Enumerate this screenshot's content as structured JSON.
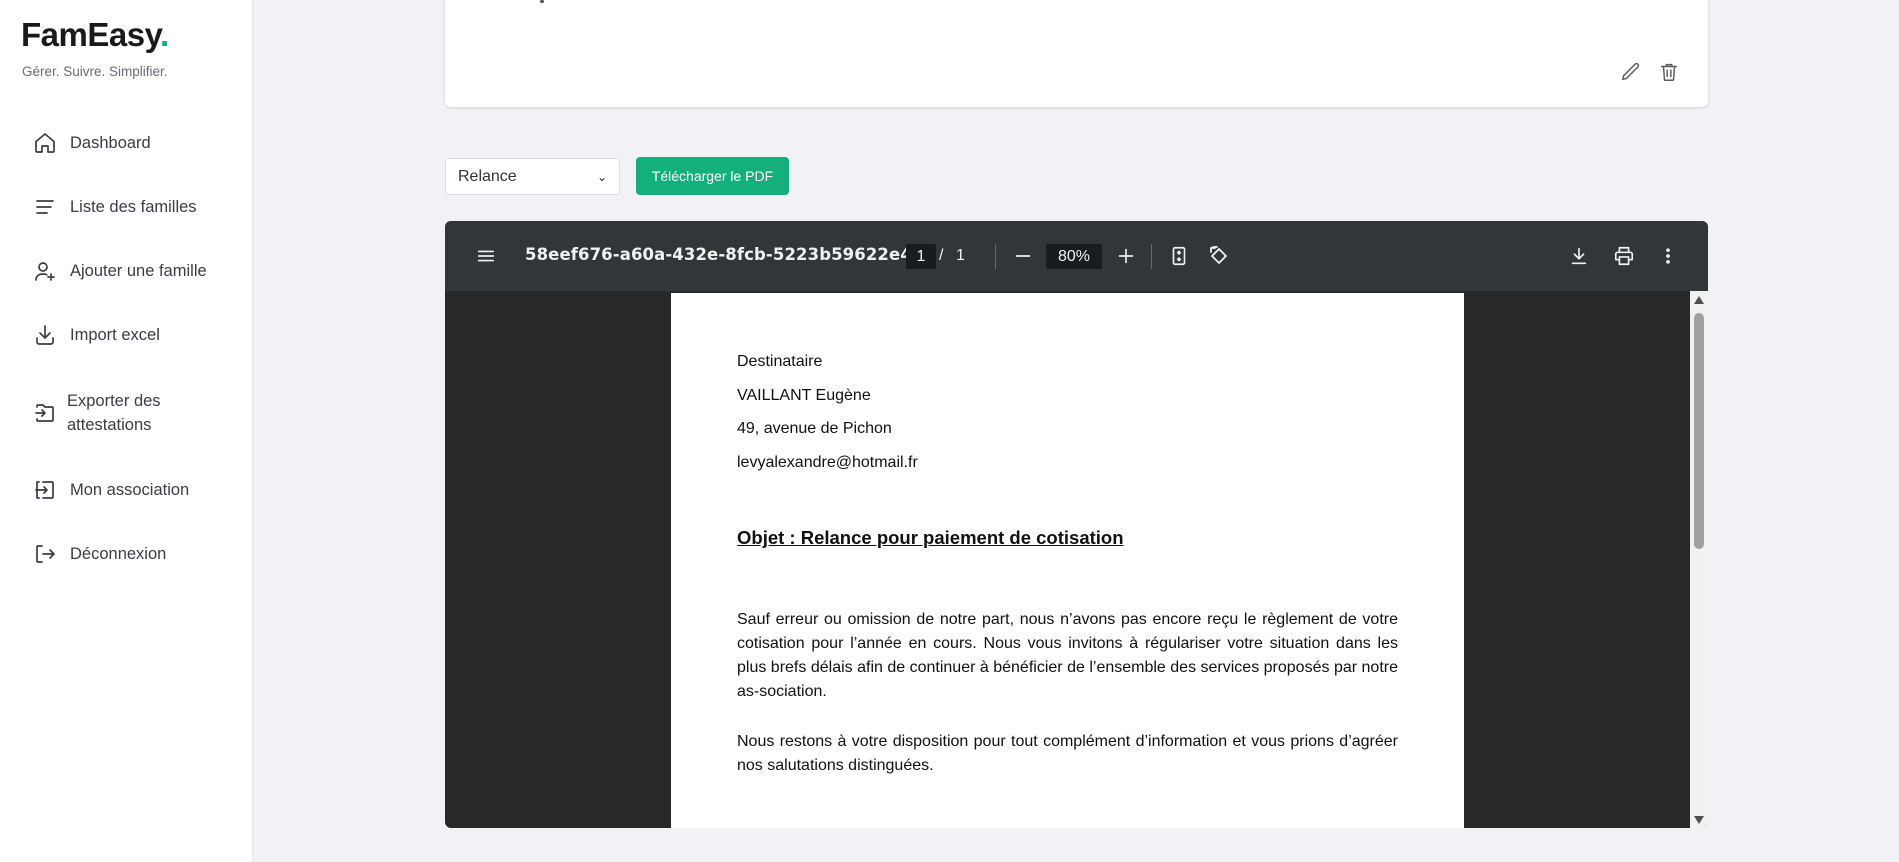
{
  "brand": {
    "name": "FamEasy",
    "dot": ".",
    "tagline": "Gérer. Suivre. Simplifier."
  },
  "sidebar": {
    "items": [
      {
        "label": "Dashboard",
        "icon": "home-icon"
      },
      {
        "label": "Liste des familles",
        "icon": "list-icon"
      },
      {
        "label": "Ajouter une famille",
        "icon": "user-plus-icon"
      },
      {
        "label": "Import excel",
        "icon": "download-icon"
      },
      {
        "label": "Exporter des attestations",
        "icon": "export-icon"
      },
      {
        "label": "Mon association",
        "icon": "login-icon"
      },
      {
        "label": "Déconnexion",
        "icon": "logout-icon"
      }
    ]
  },
  "card": {
    "actions": [
      "pencil-icon",
      "trash-icon"
    ]
  },
  "controls": {
    "select_value": "Relance",
    "download_button": "Télécharger le PDF",
    "accent_color": "#14b07c"
  },
  "viewer": {
    "document_title": "58eef676-a60a-432e-8fcb-5223b59622e4",
    "current_page": "1",
    "page_separator": "/",
    "total_pages": "1",
    "zoom": "80%"
  },
  "letter": {
    "recipient_label": "Destinataire",
    "recipient_name": "VAILLANT Eugène",
    "recipient_address": "49, avenue de Pichon",
    "recipient_email": "levyalexandre@hotmail.fr",
    "subject": "Objet : Relance pour paiement de cotisation",
    "paragraph_1": "Sauf erreur ou omission de notre part, nous n’avons pas encore reçu le règlement de votre cotisation pour l’année en cours. Nous vous invitons à régulariser votre situation dans les plus brefs délais afin de continuer à bénéficier de l’ensemble des services proposés par notre as-sociation.",
    "paragraph_2": "Nous restons à votre disposition pour tout complément d’information et vous prions d’agréer nos salutations distinguées."
  }
}
